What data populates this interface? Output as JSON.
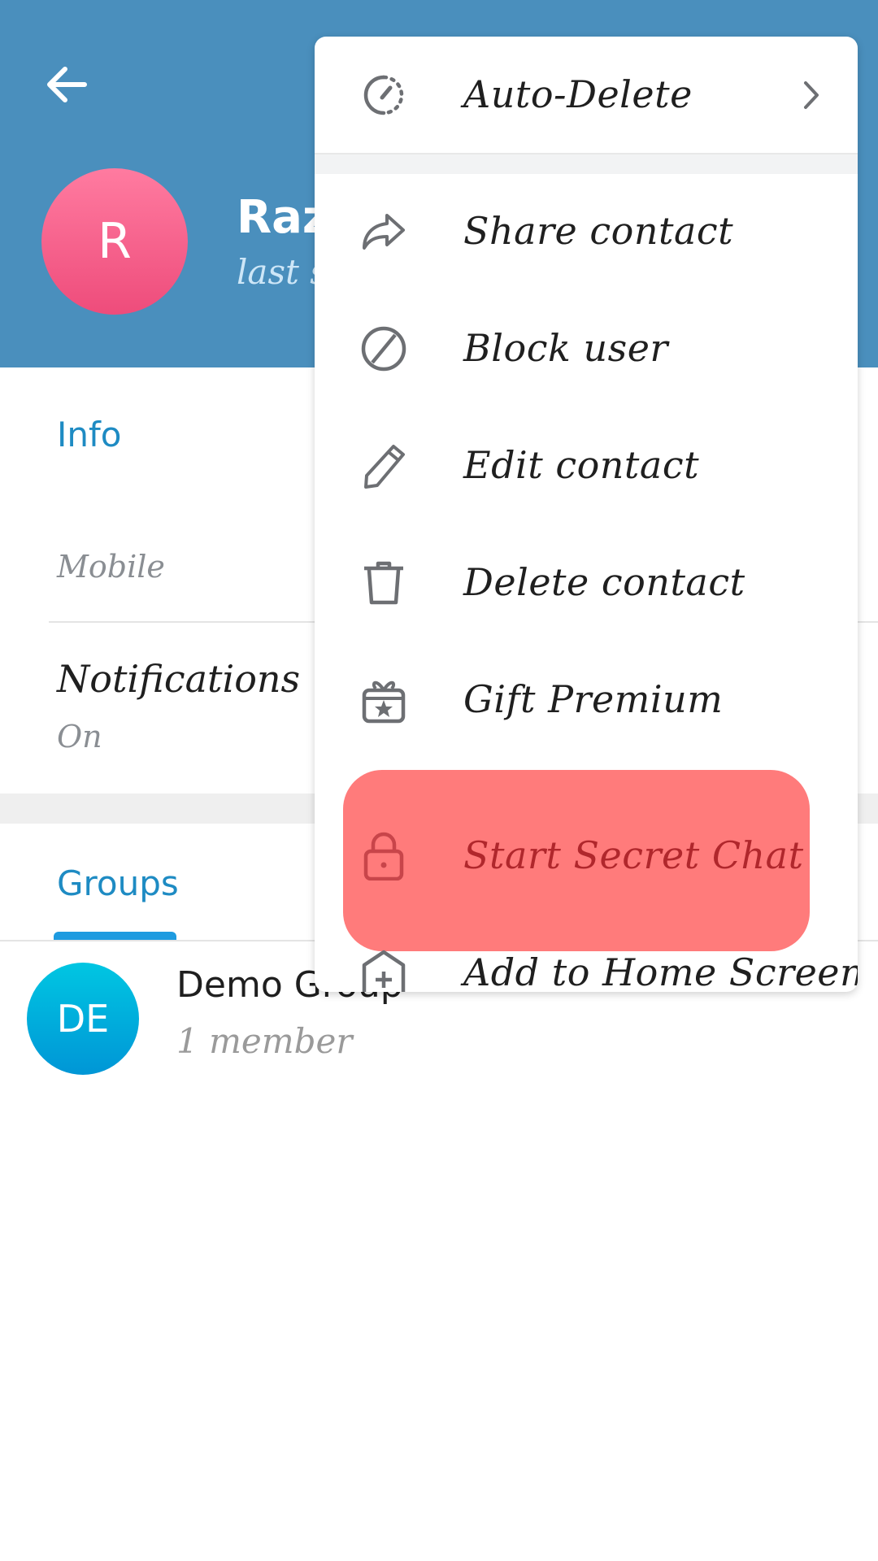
{
  "header": {
    "back_icon": "arrow-left-icon",
    "avatar_initial": "R",
    "name_visible": "Raz",
    "status_visible": "last s",
    "bg_color": "#4A8FBD"
  },
  "info": {
    "section_title": "Info",
    "mobile_label": "Mobile",
    "notifications_label": "Notifications",
    "notifications_value": "On"
  },
  "groups": {
    "tab_label": "Groups",
    "items": [
      {
        "initials": "DE",
        "name": "Demo Group",
        "subtitle": "1 member"
      }
    ]
  },
  "menu": {
    "items": [
      {
        "label": "Auto-Delete",
        "icon": "timer-icon",
        "has_submenu": true
      },
      {
        "label": "Share contact",
        "icon": "share-icon"
      },
      {
        "label": "Block user",
        "icon": "block-icon"
      },
      {
        "label": "Edit contact",
        "icon": "pencil-icon"
      },
      {
        "label": "Delete contact",
        "icon": "trash-icon"
      },
      {
        "label": "Gift Premium",
        "icon": "gift-icon"
      },
      {
        "label": "Start Secret Chat",
        "icon": "lock-icon",
        "highlighted": true
      },
      {
        "label": "Add to Home Screen",
        "icon": "add-home-icon"
      }
    ],
    "highlight_color": "#FF7B7B",
    "highlight_text_color": "#B0272C"
  }
}
